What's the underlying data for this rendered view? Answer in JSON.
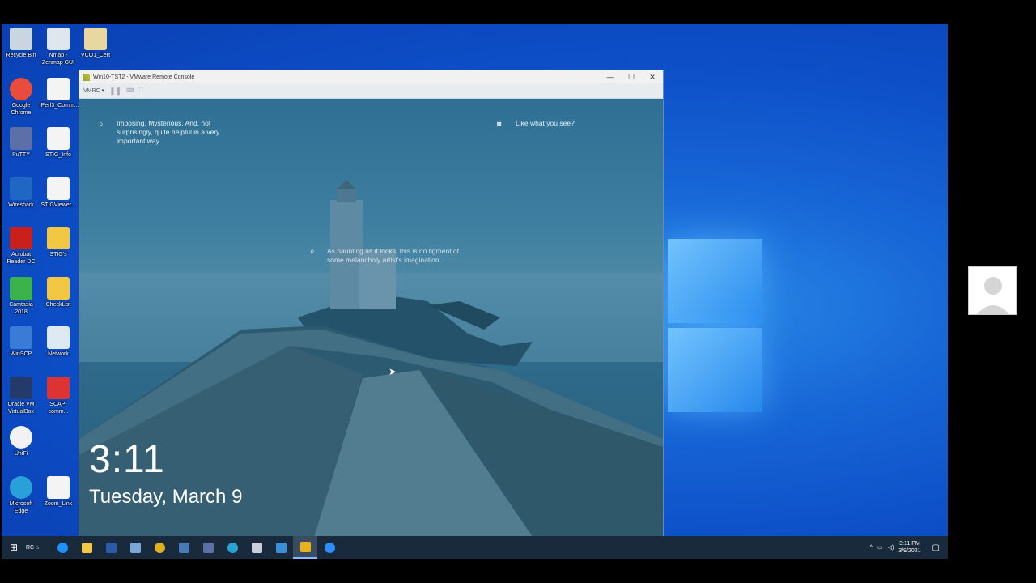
{
  "desktop_icons": [
    {
      "label": "Recycle Bin",
      "icon": "recycle-bin-icon"
    },
    {
      "label": "Nmap - Zenmap GUI",
      "icon": "nmap-icon"
    },
    {
      "label": "VCO1_Cert",
      "icon": "certificate-icon"
    },
    {
      "label": "Google Chrome",
      "icon": "chrome-icon"
    },
    {
      "label": "iPerf3_Comm...",
      "icon": "file-icon"
    },
    {
      "label": "PuTTY",
      "icon": "putty-icon"
    },
    {
      "label": "STIG_Info",
      "icon": "file-icon"
    },
    {
      "label": "Wireshark",
      "icon": "wireshark-icon"
    },
    {
      "label": "STIGViewer...",
      "icon": "file-icon"
    },
    {
      "label": "Acrobat Reader DC",
      "icon": "acrobat-icon"
    },
    {
      "label": "STIG's",
      "icon": "folder-icon"
    },
    {
      "label": "Camtasia 2018",
      "icon": "camtasia-icon"
    },
    {
      "label": "CheckList",
      "icon": "folder-icon"
    },
    {
      "label": "WinSCP",
      "icon": "winscp-icon"
    },
    {
      "label": "Network",
      "icon": "network-icon"
    },
    {
      "label": "Oracle VM VirtualBox",
      "icon": "virtualbox-icon"
    },
    {
      "label": "SCAP-comm...",
      "icon": "pdf-icon"
    },
    {
      "label": "UniFi",
      "icon": "unifi-icon"
    },
    {
      "label": "Microsoft Edge",
      "icon": "edge-icon"
    },
    {
      "label": "Zoom_Link",
      "icon": "file-icon"
    }
  ],
  "vmrc": {
    "title": "Win10-TST2 - VMware Remote Console",
    "menu_label": "VMRC ▾",
    "minimize": "—",
    "maximize": "☐",
    "close": "✕"
  },
  "lockscreen": {
    "tip_1": "Imposing. Mysterious. And, not surprisingly, quite helpful in a very important way.",
    "tip_2": "Like what you see?",
    "tip_3": "As haunting as it looks, this is no figment of some melancholy artist's imagination...",
    "time": "3:11",
    "date": "Tuesday, March 9"
  },
  "taskbar": {
    "start_label": "⊞",
    "pinned": [
      {
        "name": "ie-icon",
        "color": "#1e90ff"
      },
      {
        "name": "file-explorer-icon",
        "color": "#f2c744"
      },
      {
        "name": "powershell-icon",
        "color": "#2b5aa8"
      },
      {
        "name": "network-tool-icon",
        "color": "#7aa7d8"
      },
      {
        "name": "chrome-icon",
        "color": "#e0b020"
      },
      {
        "name": "remote-desktop-icon",
        "color": "#4a7ab5"
      },
      {
        "name": "putty-icon",
        "color": "#5c6fa8"
      },
      {
        "name": "edge-icon",
        "color": "#28a4d9"
      },
      {
        "name": "scripts-icon",
        "color": "#c8d0d8"
      },
      {
        "name": "window-app-icon",
        "color": "#3b8fd6"
      },
      {
        "name": "vmrc-icon",
        "color": "#e8b21a"
      },
      {
        "name": "zoom-icon",
        "color": "#2d8cff"
      }
    ],
    "rc_label": "RC",
    "clock_time": "3:11 PM",
    "clock_date": "3/9/2021"
  }
}
